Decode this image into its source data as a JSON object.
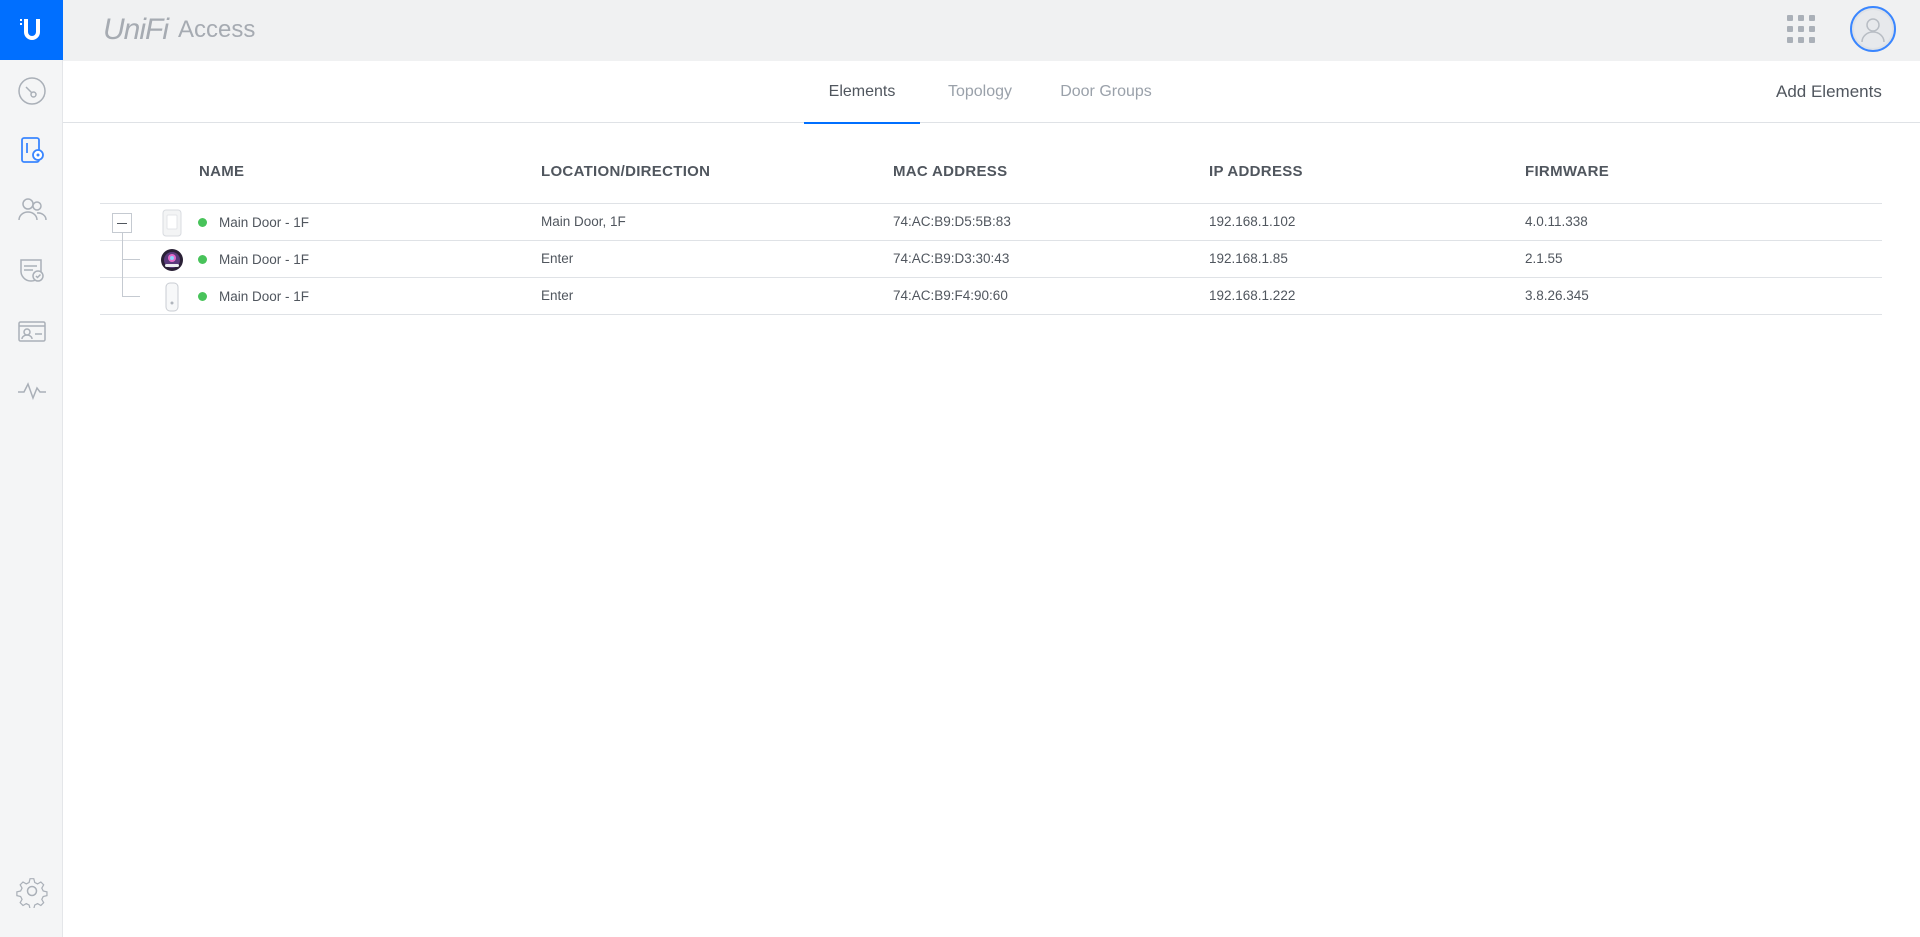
{
  "brand": {
    "name": "UniFi",
    "product": "Access"
  },
  "sidebar": {
    "items": [
      {
        "name": "dashboard-icon"
      },
      {
        "name": "doors-icon"
      },
      {
        "name": "users-icon"
      },
      {
        "name": "policies-icon"
      },
      {
        "name": "credentials-icon"
      },
      {
        "name": "activity-icon"
      },
      {
        "name": "settings-icon"
      }
    ]
  },
  "tabs": [
    {
      "label": "Elements",
      "active": true
    },
    {
      "label": "Topology",
      "active": false
    },
    {
      "label": "Door Groups",
      "active": false
    }
  ],
  "actions": {
    "add_elements": "Add Elements"
  },
  "table": {
    "columns": [
      "NAME",
      "LOCATION/DIRECTION",
      "MAC ADDRESS",
      "IP ADDRESS",
      "FIRMWARE"
    ],
    "rows": [
      {
        "name": "Main Door - 1F",
        "location": "Main Door, 1F",
        "mac": "74:AC:B9:D5:5B:83",
        "ip": "192.168.1.102",
        "firmware": "4.0.11.338",
        "status": "online",
        "device": "hub"
      },
      {
        "name": "Main Door - 1F",
        "location": "Enter",
        "mac": "74:AC:B9:D3:30:43",
        "ip": "192.168.1.85",
        "firmware": "2.1.55",
        "status": "online",
        "device": "reader-pro"
      },
      {
        "name": "Main Door - 1F",
        "location": "Enter",
        "mac": "74:AC:B9:F4:90:60",
        "ip": "192.168.1.222",
        "firmware": "3.8.26.345",
        "status": "online",
        "device": "reader-lite"
      }
    ]
  },
  "colors": {
    "accent": "#006fff",
    "online": "#48c35a"
  }
}
